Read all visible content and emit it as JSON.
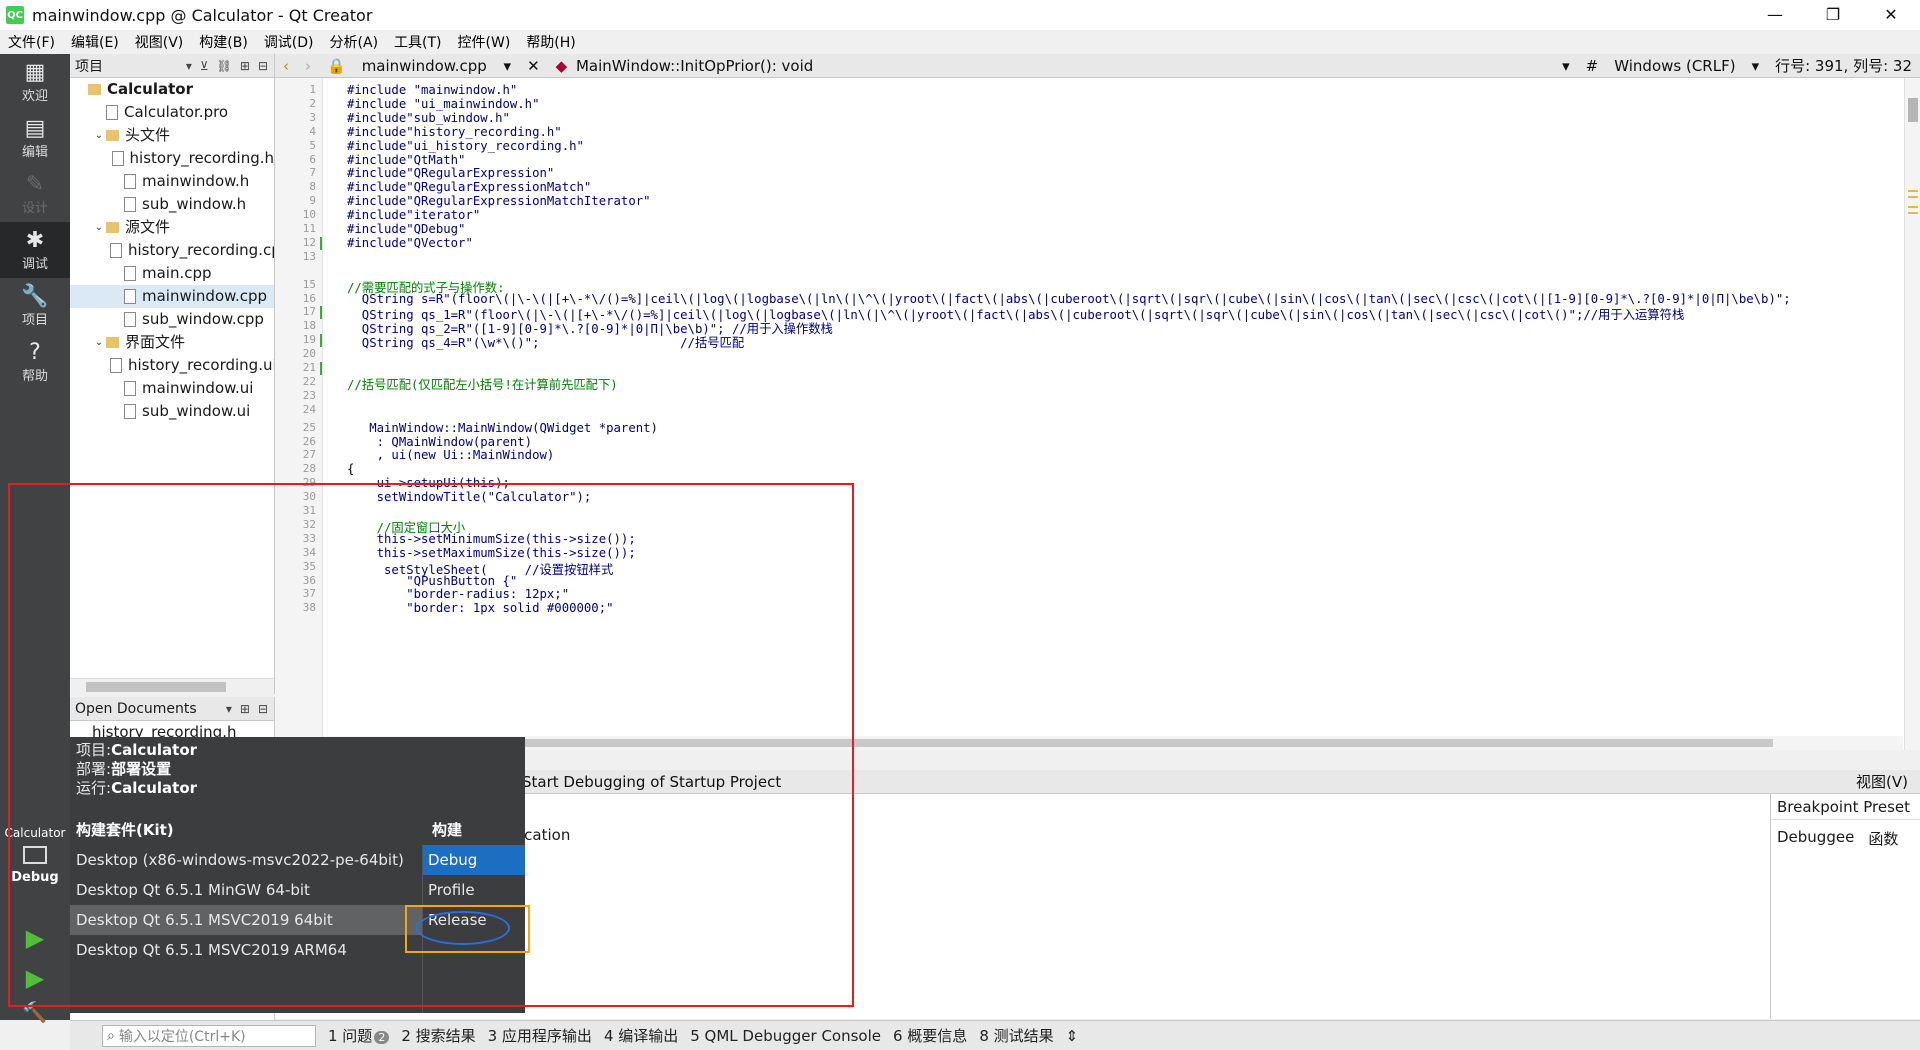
{
  "window": {
    "title": "mainwindow.cpp @ Calculator - Qt Creator",
    "logo": "QC",
    "controls": [
      "—",
      "❐",
      "✕"
    ]
  },
  "menubar": [
    "文件(F)",
    "编辑(E)",
    "视图(V)",
    "构建(B)",
    "调试(D)",
    "分析(A)",
    "工具(T)",
    "控件(W)",
    "帮助(H)"
  ],
  "modes": [
    {
      "label": "欢迎",
      "icon": "grid-icon",
      "glyph": "▦"
    },
    {
      "label": "编辑",
      "icon": "document-icon",
      "glyph": "▤"
    },
    {
      "label": "设计",
      "icon": "pencil-icon",
      "glyph": "✎"
    },
    {
      "label": "调试",
      "icon": "bug-icon",
      "glyph": "✱"
    },
    {
      "label": "项目",
      "icon": "wrench-icon",
      "glyph": "🔧"
    },
    {
      "label": "帮助",
      "icon": "help-icon",
      "glyph": "?"
    }
  ],
  "project_panel": {
    "header": "项目",
    "tree": [
      {
        "label": "Calculator",
        "level": 0,
        "kind": "project",
        "arrow": "",
        "bold": true
      },
      {
        "label": "Calculator.pro",
        "level": 1,
        "kind": "file",
        "arrow": ""
      },
      {
        "label": "头文件",
        "level": 1,
        "kind": "folder",
        "arrow": "⌄"
      },
      {
        "label": "history_recording.h",
        "level": 2,
        "kind": "file",
        "arrow": ""
      },
      {
        "label": "mainwindow.h",
        "level": 2,
        "kind": "file",
        "arrow": ""
      },
      {
        "label": "sub_window.h",
        "level": 2,
        "kind": "file",
        "arrow": ""
      },
      {
        "label": "源文件",
        "level": 1,
        "kind": "folder",
        "arrow": "⌄"
      },
      {
        "label": "history_recording.cpp",
        "level": 2,
        "kind": "file",
        "arrow": ""
      },
      {
        "label": "main.cpp",
        "level": 2,
        "kind": "file",
        "arrow": ""
      },
      {
        "label": "mainwindow.cpp",
        "level": 2,
        "kind": "file",
        "arrow": "",
        "selected": true
      },
      {
        "label": "sub_window.cpp",
        "level": 2,
        "kind": "file",
        "arrow": ""
      },
      {
        "label": "界面文件",
        "level": 1,
        "kind": "folder",
        "arrow": "⌄"
      },
      {
        "label": "history_recording.ui",
        "level": 2,
        "kind": "file",
        "arrow": ""
      },
      {
        "label": "mainwindow.ui",
        "level": 2,
        "kind": "file",
        "arrow": ""
      },
      {
        "label": "sub_window.ui",
        "level": 2,
        "kind": "file",
        "arrow": ""
      }
    ]
  },
  "open_documents": {
    "header": "Open Documents",
    "items": [
      "history_recording.h"
    ]
  },
  "editor_toolbar": {
    "file": "mainwindow.cpp",
    "function": "MainWindow::InitOpPrior(): void",
    "hash": "#",
    "line_ending": "Windows (CRLF)",
    "position": "行号: 391, 列号: 32"
  },
  "code_lines": [
    {
      "n": "1",
      "text": "#include \"mainwindow.h\"",
      "cls": "code"
    },
    {
      "n": "2",
      "text": "#include \"ui_mainwindow.h\"",
      "cls": "code"
    },
    {
      "n": "3",
      "text": "#include\"sub_window.h\"",
      "cls": "code"
    },
    {
      "n": "4",
      "text": "#include\"history_recording.h\"",
      "cls": "code"
    },
    {
      "n": "5",
      "text": "#include\"ui_history_recording.h\"",
      "cls": "code"
    },
    {
      "n": "6",
      "text": "#include\"QtMath\"",
      "cls": "code"
    },
    {
      "n": "7",
      "text": "#include\"QRegularExpression\"",
      "cls": "code"
    },
    {
      "n": "8",
      "text": "#include\"QRegularExpressionMatch\"",
      "cls": "code"
    },
    {
      "n": "9",
      "text": "#include\"QRegularExpressionMatchIterator\"",
      "cls": "code"
    },
    {
      "n": "10",
      "text": "#include\"iterator\"",
      "cls": "code"
    },
    {
      "n": "11",
      "text": "#include\"QDebug\"",
      "cls": "code"
    },
    {
      "n": "12",
      "text": "#include\"QVector\"",
      "cls": "code"
    },
    {
      "n": "13",
      "text": "",
      "cls": "code"
    },
    {
      "n": "15",
      "text": "//需要匹配的式子与操作数:",
      "cls": "code comment"
    },
    {
      "n": "16",
      "text": "  QString s=R\"(floor\\(|\\-\\(|[+\\-*\\/()=%]|ceil\\(|log\\(|logbase\\(|ln\\(|\\^\\(|yroot\\(|fact\\(|abs\\(|cuberoot\\(|sqrt\\(|sqr\\(|cube\\(|sin\\(|cos\\(|tan\\(|sec\\(|csc\\(|cot\\(|[1-9][0-9]*\\.?[0-9]*|0|Π|\\be\\b)\";",
      "cls": "code"
    },
    {
      "n": "17",
      "text": "  QString qs_1=R\"(floor\\(|\\-\\(|[+\\-*\\/()=%]|ceil\\(|log\\(|logbase\\(|ln\\(|\\^\\(|yroot\\(|fact\\(|abs\\(|cuberoot\\(|sqrt\\(|sqr\\(|cube\\(|sin\\(|cos\\(|tan\\(|sec\\(|csc\\(|cot\\()\";//用于入运算符栈",
      "cls": "code"
    },
    {
      "n": "18",
      "text": "  QString qs_2=R\"([1-9][0-9]*\\.?[0-9]*|0|Π|\\be\\b)\"; //用于入操作数栈",
      "cls": "code"
    },
    {
      "n": "19",
      "text": "  QString qs_4=R\"(\\w*\\()\";                   //括号匹配",
      "cls": "code"
    },
    {
      "n": "20",
      "text": "",
      "cls": "code"
    },
    {
      "n": "21",
      "text": "",
      "cls": "code"
    },
    {
      "n": "22",
      "text": "//括号匹配(仅匹配左小括号!在计算前先匹配下)",
      "cls": "code comment"
    },
    {
      "n": "23",
      "text": "",
      "cls": "code"
    },
    {
      "n": "24",
      "text": "",
      "cls": "code"
    },
    {
      "n": "25",
      "text": "   MainWindow::MainWindow(QWidget *parent)",
      "cls": "code"
    },
    {
      "n": "26",
      "text": "    : QMainWindow(parent)",
      "cls": "code"
    },
    {
      "n": "27",
      "text": "    , ui(new Ui::MainWindow)",
      "cls": "code"
    },
    {
      "n": "28",
      "text": "{",
      "cls": "code plain"
    },
    {
      "n": "29",
      "text": "    ui->setupUi(this);",
      "cls": "code"
    },
    {
      "n": "30",
      "text": "    setWindowTitle(\"Calculator\");",
      "cls": "code"
    },
    {
      "n": "31",
      "text": "",
      "cls": "code"
    },
    {
      "n": "32",
      "text": "    //固定窗口大小",
      "cls": "code comment"
    },
    {
      "n": "33",
      "text": "    this->setMinimumSize(this->size());",
      "cls": "code"
    },
    {
      "n": "34",
      "text": "    this->setMaximumSize(this->size());",
      "cls": "code"
    },
    {
      "n": "35",
      "text": "     setStyleSheet(     //设置按钮样式",
      "cls": "code"
    },
    {
      "n": "36",
      "text": "        \"QPushButton {\"",
      "cls": "code"
    },
    {
      "n": "37",
      "text": "        \"border-radius: 12px;\"",
      "cls": "code"
    },
    {
      "n": "38",
      "text": "        \"border: 1px solid #000000;\"",
      "cls": "code"
    }
  ],
  "debug_bar": {
    "start": "Start Debugging of Startup Project",
    "views": "视图(V)"
  },
  "debug_area": {
    "stub": "ication"
  },
  "right_pane": {
    "header": "Breakpoint Preset",
    "col1": "Debuggee",
    "col2": "函数"
  },
  "kit_popup": {
    "project_label": "项目:",
    "project_value": "Calculator",
    "deploy_label": "部署:",
    "deploy_value": "部署设置",
    "run_label": "运行:",
    "run_value": "Calculator",
    "kit_header": "构建套件(Kit)",
    "build_header": "构建",
    "kits": [
      "Desktop (x86-windows-msvc2022-pe-64bit)",
      "Desktop Qt 6.5.1 MinGW 64-bit",
      "Desktop Qt 6.5.1 MSVC2019 64bit",
      "Desktop Qt 6.5.1 MSVC2019 ARM64"
    ],
    "selected_kit": 2,
    "builds": [
      "Debug",
      "Profile",
      "Release"
    ],
    "selected_build": 0
  },
  "kit_selector": {
    "name": "Calculator",
    "config": "Debug"
  },
  "statusbar": {
    "search_placeholder": "输入以定位(Ctrl+K)",
    "tabs": [
      "1 问题",
      "2 搜索结果",
      "3 应用程序输出",
      "4 编译输出",
      "5 QML Debugger Console",
      "6 概要信息",
      "8 测试结果"
    ],
    "issues_badge": "2",
    "more": "⇕"
  }
}
